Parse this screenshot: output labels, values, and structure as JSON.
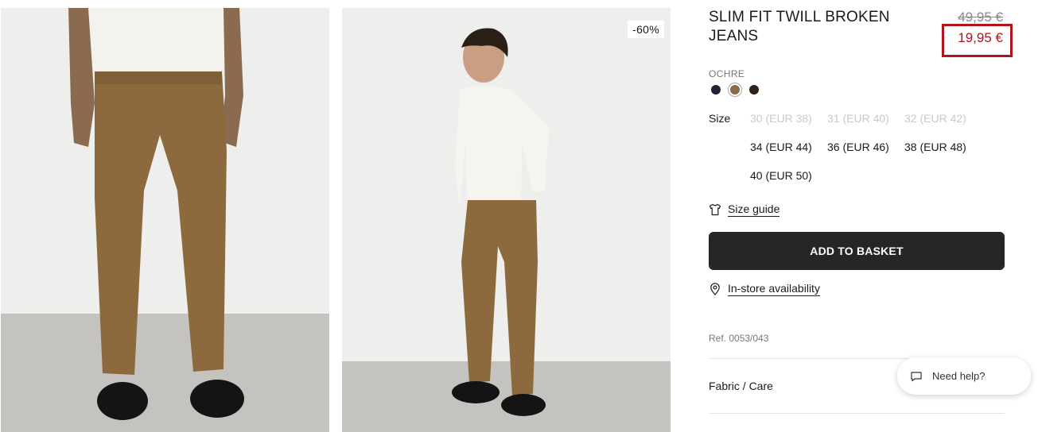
{
  "gallery": {
    "discount_badge": "-60%"
  },
  "product": {
    "title": "SLIM FIT TWILL BROKEN JEANS",
    "price_old": "49,95 €",
    "price_new": "19,95 €",
    "color_name": "OCHRE",
    "swatches": [
      {
        "color": "#1f2533",
        "selected": false
      },
      {
        "color": "#8a6a47",
        "selected": true
      },
      {
        "color": "#2e221a",
        "selected": false
      }
    ],
    "size_label": "Size",
    "sizes": [
      {
        "label": "30 (EUR 38)",
        "available": false
      },
      {
        "label": "31 (EUR 40)",
        "available": false
      },
      {
        "label": "32 (EUR 42)",
        "available": false
      },
      {
        "label": "34 (EUR 44)",
        "available": true
      },
      {
        "label": "36 (EUR 46)",
        "available": true
      },
      {
        "label": "38 (EUR 48)",
        "available": true
      },
      {
        "label": "40 (EUR 50)",
        "available": true
      }
    ],
    "size_guide_label": "Size guide",
    "add_to_basket_label": "ADD TO BASKET",
    "in_store_label": "In-store availability",
    "ref": "Ref. 0053/043",
    "fabric_care_label": "Fabric / Care"
  },
  "help_widget": {
    "label": "Need help?"
  },
  "colors": {
    "sale_red": "#b0131c",
    "button_dark": "#262626"
  }
}
